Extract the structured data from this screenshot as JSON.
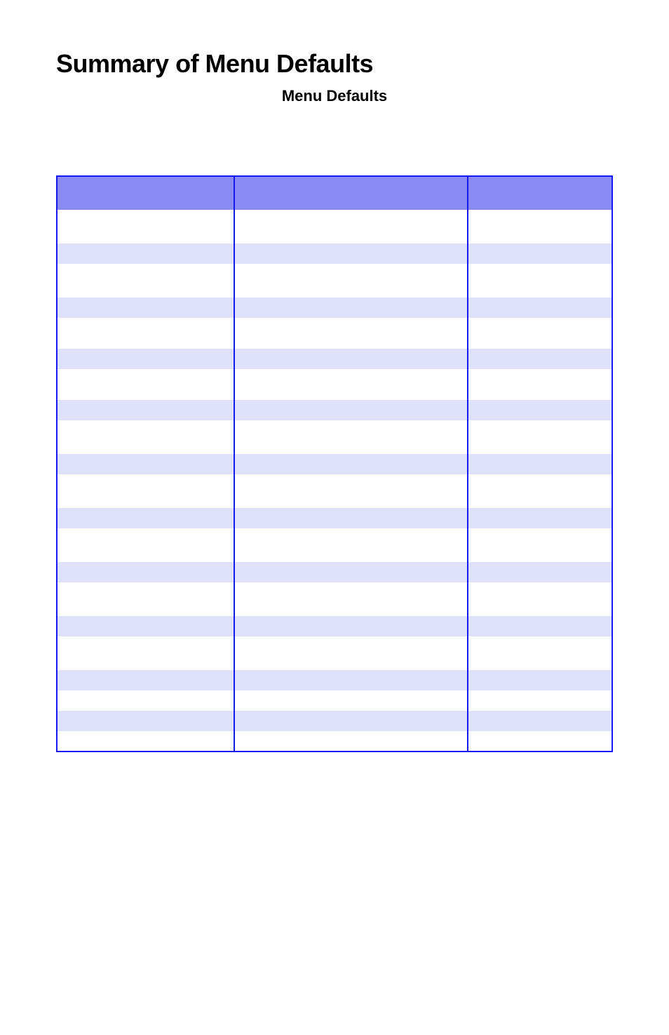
{
  "page": {
    "title": "Summary of Menu Defaults",
    "caption": "Menu Defaults"
  },
  "table": {
    "headers": [
      "",
      "",
      ""
    ],
    "rows": [
      [
        "",
        "",
        ""
      ],
      [
        "",
        "",
        ""
      ],
      [
        "",
        "",
        ""
      ],
      [
        "",
        "",
        ""
      ],
      [
        "",
        "",
        ""
      ],
      [
        "",
        "",
        ""
      ],
      [
        "",
        "",
        ""
      ],
      [
        "",
        "",
        ""
      ],
      [
        "",
        "",
        ""
      ],
      [
        "",
        "",
        ""
      ],
      [
        "",
        "",
        ""
      ],
      [
        "",
        "",
        ""
      ],
      [
        "",
        "",
        ""
      ],
      [
        "",
        "",
        ""
      ],
      [
        "",
        "",
        ""
      ],
      [
        "",
        "",
        ""
      ],
      [
        "",
        "",
        ""
      ],
      [
        "",
        "",
        ""
      ],
      [
        "",
        "",
        ""
      ],
      [
        "",
        "",
        ""
      ],
      [
        "",
        "",
        ""
      ]
    ],
    "row_heights": [
      "h-lg",
      "h-sm",
      "h-lg",
      "h-sm",
      "h-md",
      "h-sm",
      "h-md",
      "h-sm",
      "h-lg",
      "h-sm",
      "h-lg",
      "h-sm",
      "h-lg",
      "h-sm",
      "h-lg",
      "h-sm",
      "h-lg",
      "h-sm",
      "h-sm",
      "h-sm",
      "h-sm"
    ]
  }
}
